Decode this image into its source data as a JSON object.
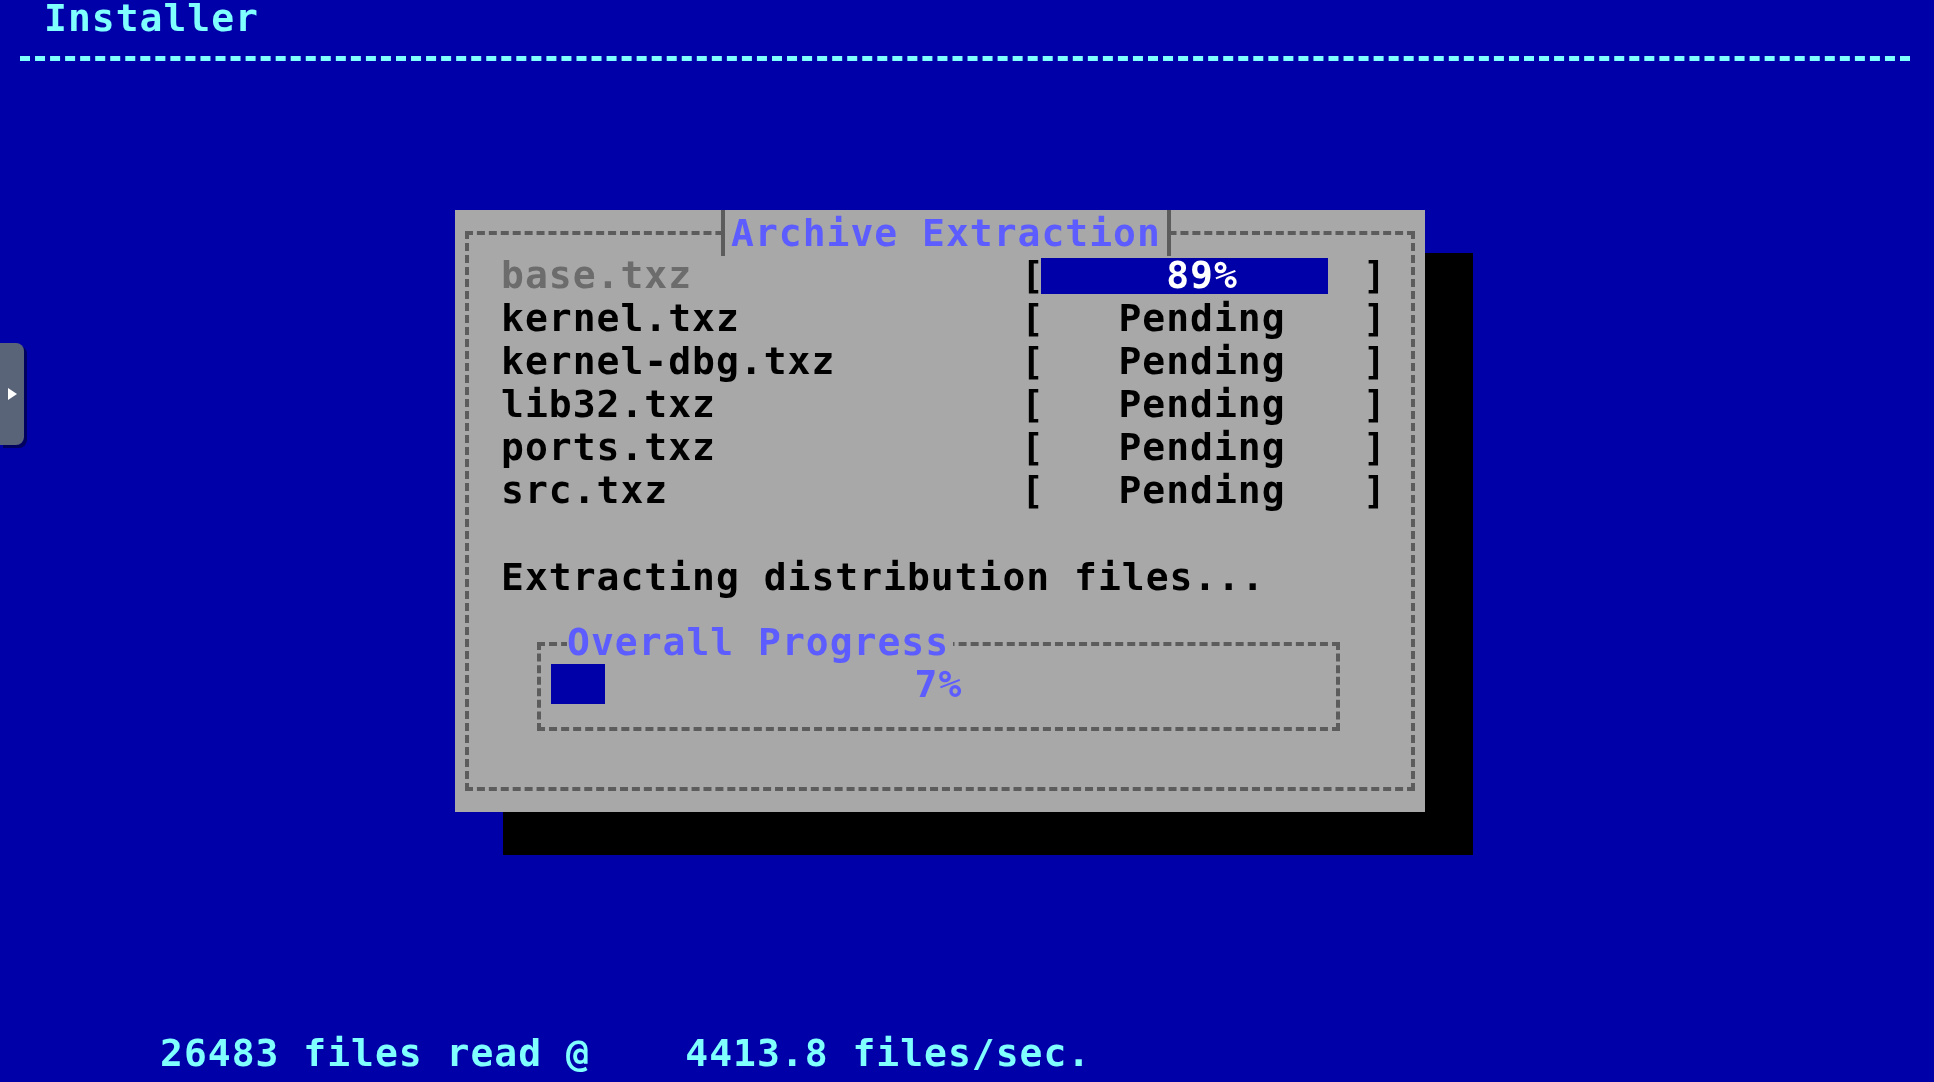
{
  "header": {
    "title": "Installer"
  },
  "dialog": {
    "title": "Archive Extraction",
    "items": [
      {
        "name": "base.txz",
        "kind": "progress",
        "active": true,
        "open": "[",
        "close": "]",
        "status": "89%",
        "level": 0.89
      },
      {
        "name": "kernel.txz",
        "kind": "text",
        "active": false,
        "open": "[",
        "close": "]",
        "status": "Pending"
      },
      {
        "name": "kernel-dbg.txz",
        "kind": "text",
        "active": false,
        "open": "[",
        "close": "]",
        "status": "Pending"
      },
      {
        "name": "lib32.txz",
        "kind": "text",
        "active": false,
        "open": "[",
        "close": "]",
        "status": "Pending"
      },
      {
        "name": "ports.txz",
        "kind": "text",
        "active": false,
        "open": "[",
        "close": "]",
        "status": "Pending"
      },
      {
        "name": "src.txz",
        "kind": "text",
        "active": false,
        "open": "[",
        "close": "]",
        "status": "Pending"
      }
    ],
    "message": "Extracting distribution files...",
    "overall": {
      "title": "Overall Progress",
      "reading": "7%",
      "level": 0.07
    }
  },
  "status_bar": {
    "text": "26483 files read @    4413.8 files/sec."
  }
}
